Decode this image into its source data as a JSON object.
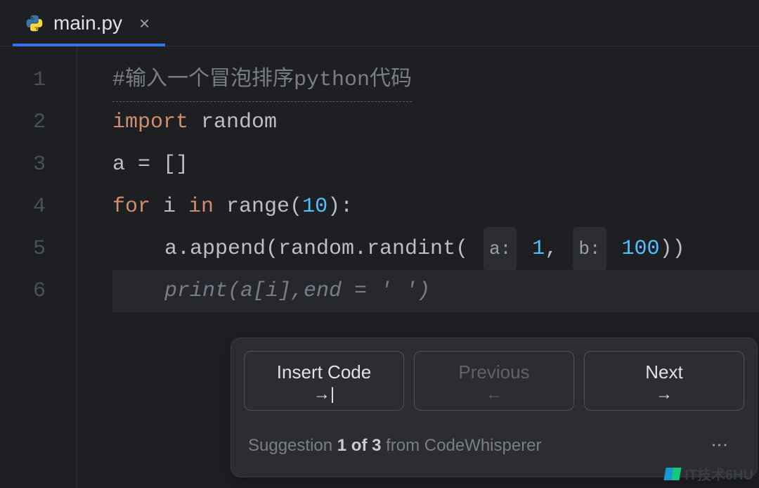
{
  "tab": {
    "filename": "main.py",
    "close_glyph": "×"
  },
  "gutter": [
    "1",
    "2",
    "3",
    "4",
    "5",
    "6"
  ],
  "code": {
    "l1_comment": "#输入一个冒泡排序python代码",
    "l2_kw": "import",
    "l2_mod": " random",
    "l3": "a = []",
    "l4_kw1": "for",
    "l4_mid": " i ",
    "l4_kw2": "in",
    "l4_fn": " range",
    "l4_open": "(",
    "l4_num": "10",
    "l4_close": "):",
    "l5_pre": "a.append(random.randint( ",
    "l5_hint_a": "a:",
    "l5_arg1": " 1",
    "l5_comma": ", ",
    "l5_hint_b": "b:",
    "l5_arg2": " 100",
    "l5_close": "))",
    "l6_fn": "print",
    "l6_open": "(",
    "l6_args": "a[i],end = ",
    "l6_str": "' '",
    "l6_close": ")"
  },
  "popup": {
    "insert": "Insert Code",
    "insert_icon": "→|",
    "prev": "Previous",
    "prev_icon": "←",
    "next": "Next",
    "next_icon": "→",
    "status_pre": "Suggestion ",
    "status_bold": "1 of 3",
    "status_post": " from CodeWhisperer",
    "kebab": "⋮"
  },
  "watermark": "IT技术6HU"
}
